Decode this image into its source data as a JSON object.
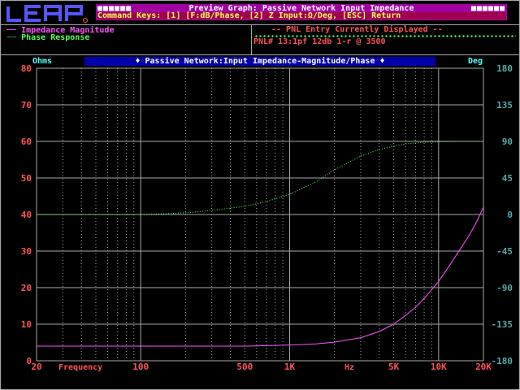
{
  "app": {
    "logo_text": "LEAP"
  },
  "titlebar": {
    "line1": "Preview Graph: Passive Network Input Impedance",
    "line2": "Command Keys: [1] [F:dB/Phase, [2] Z Input:Ω/Deg, [ESC] Return",
    "dots": "■■■■■■"
  },
  "legend": {
    "impedance": "Impedance Magnitude",
    "phase": "Phase Response"
  },
  "pnl": {
    "header": "-- PNL Entry Currently Displayed --",
    "entry": "PNL# 13:1pf 12db 1-r @ 3500"
  },
  "graph": {
    "title": "♦ Passive Network:Input Impedance-Magnitude/Phase ♦",
    "left_unit": "Ohms",
    "right_unit": "Deg",
    "freq_label": "Frequency",
    "hz_label": "Hz"
  },
  "colors": {
    "magnitude": "#ff55ff",
    "phase": "#55ff55",
    "left_axis": "#ff5555",
    "right_axis": "#55aaaa",
    "grid": "#a8a8a8",
    "title_bg": "#0000aa"
  },
  "chart_data": {
    "type": "line",
    "x_scale": "log",
    "xlim": [
      20,
      20000
    ],
    "ylim_left": [
      0,
      80
    ],
    "ylim_right": [
      -180,
      180
    ],
    "left_ticks": [
      "80",
      "70",
      "60",
      "50",
      "40",
      "30",
      "20",
      "10",
      "0"
    ],
    "right_ticks": [
      "180",
      "135",
      "90",
      "45",
      "0",
      "-45",
      "-90",
      "-135",
      "-180"
    ],
    "x_tick_labels": [
      {
        "value": 20,
        "label": "20"
      },
      {
        "value": 100,
        "label": "100"
      },
      {
        "value": 500,
        "label": "500"
      },
      {
        "value": 1000,
        "label": "1K"
      },
      {
        "value": 5000,
        "label": "5K"
      },
      {
        "value": 10000,
        "label": "10K"
      },
      {
        "value": 20000,
        "label": "20K"
      }
    ],
    "series": [
      {
        "name": "Impedance Magnitude",
        "axis": "left",
        "x": [
          20,
          100,
          500,
          800,
          1000,
          1500,
          2000,
          3000,
          4000,
          5000,
          6000,
          7000,
          8000,
          10000,
          12000,
          14000,
          16000,
          18000,
          20000
        ],
        "y": [
          4,
          4,
          4,
          4.2,
          4.3,
          4.6,
          5.1,
          6.3,
          8,
          10,
          12.4,
          14.6,
          17,
          21.7,
          26.4,
          30.6,
          34.2,
          38,
          42
        ]
      },
      {
        "name": "Phase Response",
        "axis": "right",
        "x": [
          20,
          100,
          200,
          300,
          500,
          700,
          1000,
          1500,
          2000,
          3000,
          4000,
          5000,
          6000,
          7000,
          8000,
          10000,
          14000,
          20000
        ],
        "y": [
          0,
          0,
          2,
          5,
          10,
          16,
          25,
          40,
          55,
          72,
          80,
          84,
          87,
          88,
          89,
          89.5,
          90,
          90
        ]
      }
    ]
  }
}
